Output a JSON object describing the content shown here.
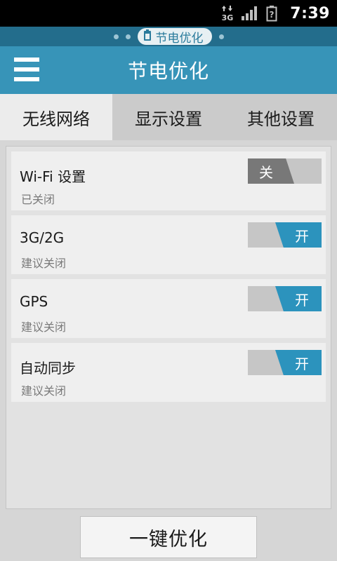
{
  "status_bar": {
    "network_type": "3G",
    "time": "7:39",
    "icons": [
      "data-transfer-3g-icon",
      "signal-strength-icon",
      "battery-unknown-icon"
    ]
  },
  "indicator": {
    "label": "节电优化",
    "icon": "battery-icon"
  },
  "header": {
    "title": "节电优化",
    "menu_icon": "hamburger-menu-icon"
  },
  "tabs": [
    {
      "label": "无线网络",
      "active": true
    },
    {
      "label": "显示设置",
      "active": false
    },
    {
      "label": "其他设置",
      "active": false
    }
  ],
  "settings": [
    {
      "title": "Wi-Fi 设置",
      "subtitle": "已关闭",
      "state": "off",
      "toggle_label": "关"
    },
    {
      "title": "3G/2G",
      "subtitle": "建议关闭",
      "state": "on",
      "toggle_label": "开"
    },
    {
      "title": "GPS",
      "subtitle": "建议关闭",
      "state": "on",
      "toggle_label": "开"
    },
    {
      "title": "自动同步",
      "subtitle": "建议关闭",
      "state": "on",
      "toggle_label": "开"
    }
  ],
  "actions": {
    "optimize_label": "一键优化"
  },
  "colors": {
    "accent": "#3794b8",
    "indicator_bg": "#236d8c",
    "toggle_on": "#2c93bd",
    "toggle_off": "#787878"
  }
}
